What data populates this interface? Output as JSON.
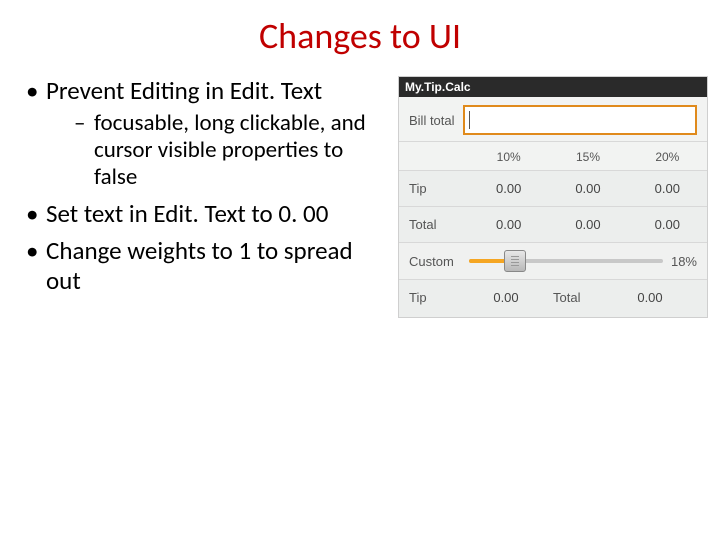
{
  "title": "Changes to UI",
  "bullets": {
    "b1": "Prevent Editing in Edit. Text",
    "b1_sub": "focusable, long clickable, and cursor visible properties to false",
    "b2": "Set text in Edit. Text to 0. 00",
    "b3": "Change weights to 1 to spread out"
  },
  "app": {
    "title": "My.Tip.Calc",
    "bill_label": "Bill total",
    "bill_value": "",
    "pct10": "10%",
    "pct15": "15%",
    "pct20": "20%",
    "tip_label": "Tip",
    "tip10": "0.00",
    "tip15": "0.00",
    "tip20": "0.00",
    "total_label": "Total",
    "total10": "0.00",
    "total15": "0.00",
    "total20": "0.00",
    "custom_label": "Custom",
    "custom_pct": "18%",
    "bottom_tip_label": "Tip",
    "bottom_tip": "0.00",
    "bottom_total_label": "Total",
    "bottom_total": "0.00"
  }
}
